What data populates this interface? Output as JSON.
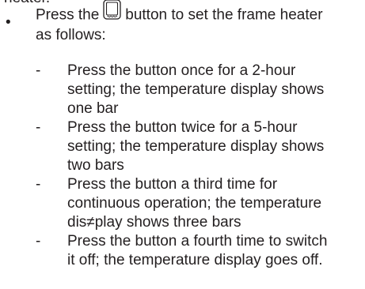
{
  "intro_fragment": "heater.",
  "bullet": {
    "marker": "•",
    "text_before_icon": "Press the",
    "icon": "frame-heater-button-icon",
    "text_after_icon": "button to set the frame heater",
    "text_line2": "as follows:"
  },
  "sub_items": [
    {
      "marker": "-",
      "lines": [
        "Press the button once for a 2-hour",
        "setting; the temperature display shows",
        "one bar"
      ]
    },
    {
      "marker": "-",
      "lines": [
        "Press the button twice for a 5-hour",
        "setting; the temperature display shows",
        "two bars"
      ]
    },
    {
      "marker": "-",
      "lines": [
        "Press the button a third time for",
        "continuous operation; the temperature",
        "dis≠play shows three bars"
      ]
    },
    {
      "marker": "-",
      "lines": [
        "Press the button a fourth time to switch",
        "it off; the temperature display goes off."
      ]
    }
  ],
  "colors": {
    "text": "#231f20"
  }
}
